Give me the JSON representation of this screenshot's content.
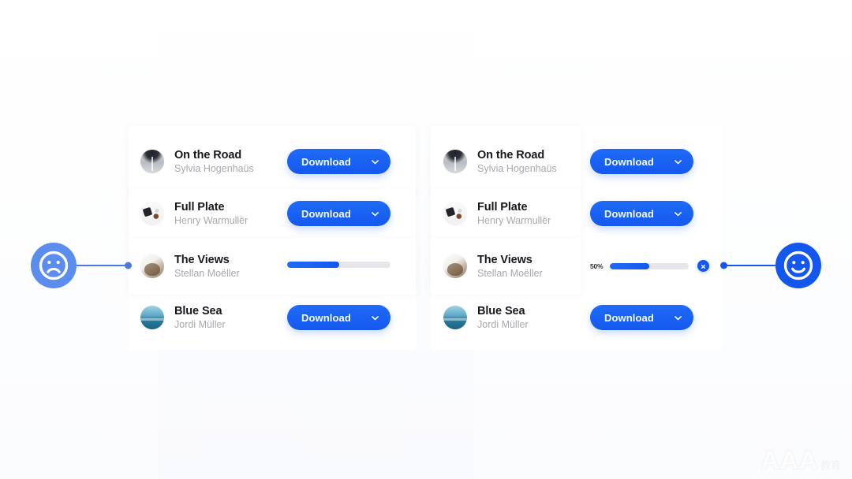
{
  "page": {
    "accent_blue": "#1558ef",
    "accent_blue_light": "#5b8def",
    "track_gray": "#e6e7ea",
    "background": "#ffffff"
  },
  "markers": {
    "bad": {
      "icon": "sad-face-icon",
      "meaning": "bad-pattern"
    },
    "good": {
      "icon": "happy-face-icon",
      "meaning": "good-pattern"
    }
  },
  "variants": [
    {
      "id": "without-progress-feedback",
      "marker": "sad",
      "rows": [
        {
          "title": "On the Road",
          "author": "Sylvia Hogenhaüs",
          "thumbnail": "road-thumbnail",
          "action": "download",
          "button_label": "Download",
          "chevron": "chevron-down-icon"
        },
        {
          "title": "Full Plate",
          "author": "Henry Warmullër",
          "thumbnail": "plate-thumbnail",
          "action": "download",
          "button_label": "Download",
          "chevron": "chevron-down-icon"
        },
        {
          "title": "The Views",
          "author": "Stellan Moëller",
          "thumbnail": "views-thumbnail",
          "action": "progress",
          "progress_percent": 50,
          "percent_label": "",
          "has_cancel": false
        },
        {
          "title": "Blue Sea",
          "author": "Jordi Müller",
          "thumbnail": "sea-thumbnail",
          "action": "download",
          "button_label": "Download",
          "chevron": "chevron-down-icon"
        }
      ]
    },
    {
      "id": "with-progress-feedback",
      "marker": "happy",
      "rows": [
        {
          "title": "On the Road",
          "author": "Sylvia Hogenhaüs",
          "thumbnail": "road-thumbnail",
          "action": "download",
          "button_label": "Download",
          "chevron": "chevron-down-icon"
        },
        {
          "title": "Full Plate",
          "author": "Henry Warmullër",
          "thumbnail": "plate-thumbnail",
          "action": "download",
          "button_label": "Download",
          "chevron": "chevron-down-icon"
        },
        {
          "title": "The Views",
          "author": "Stellan Moëller",
          "thumbnail": "views-thumbnail",
          "action": "progress",
          "progress_percent": 50,
          "percent_label": "50%",
          "has_cancel": true,
          "cancel_icon": "close-icon"
        },
        {
          "title": "Blue Sea",
          "author": "Jordi Müller",
          "thumbnail": "sea-thumbnail",
          "action": "download",
          "button_label": "Download",
          "chevron": "chevron-down-icon"
        }
      ]
    }
  ],
  "watermark": {
    "logo_text": "AAA",
    "sub_text": "教育"
  }
}
